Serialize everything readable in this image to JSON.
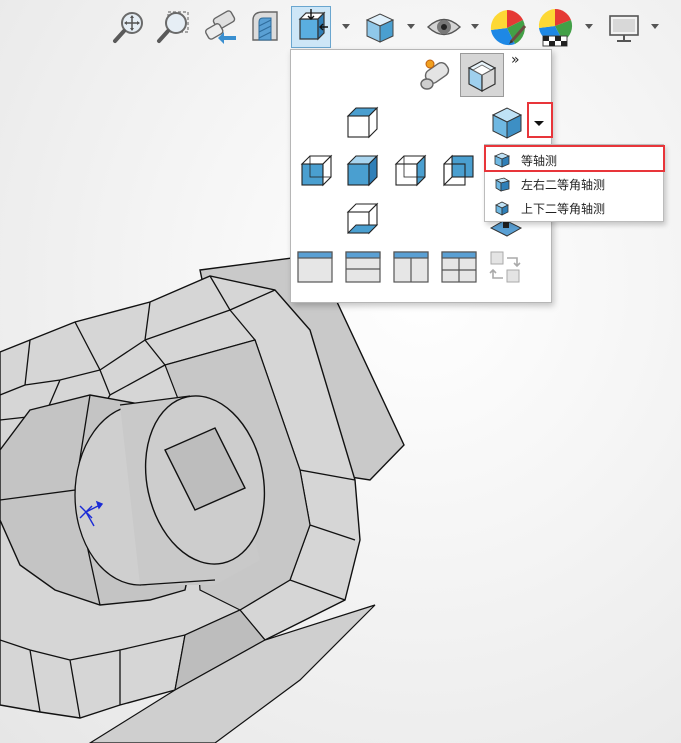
{
  "toolbar": {
    "buttons": [
      {
        "name": "zoom-to-fit",
        "icon": "zoom-fit-icon"
      },
      {
        "name": "zoom-to-area",
        "icon": "zoom-area-icon"
      },
      {
        "name": "previous-view",
        "icon": "previous-view-icon"
      },
      {
        "name": "section-view",
        "icon": "section-view-icon"
      },
      {
        "name": "view-orientation",
        "icon": "view-orientation-icon",
        "active": true
      },
      {
        "name": "display-style",
        "icon": "display-style-icon"
      },
      {
        "name": "hide-show-items",
        "icon": "eye-icon"
      },
      {
        "name": "edit-appearance",
        "icon": "appearance-icon"
      },
      {
        "name": "apply-scene",
        "icon": "scene-icon"
      },
      {
        "name": "view-settings",
        "icon": "monitor-icon"
      }
    ]
  },
  "flyout": {
    "more_glyph": "»",
    "submenu": {
      "items": [
        {
          "label": "等轴测",
          "icon": "isometric-cube-icon",
          "highlighted": true
        },
        {
          "label": "左右二等角轴测",
          "icon": "dimetric-cube-icon"
        },
        {
          "label": "上下二等角轴测",
          "icon": "trimetric-cube-icon"
        }
      ]
    }
  },
  "colors": {
    "highlight_border": "#e8353a",
    "active_button": "#cde6f7",
    "cube_blue": "#4a9fd0",
    "model_face": "#d0d0d0",
    "model_edge": "#111111",
    "triad_blue": "#1a2bd6"
  }
}
